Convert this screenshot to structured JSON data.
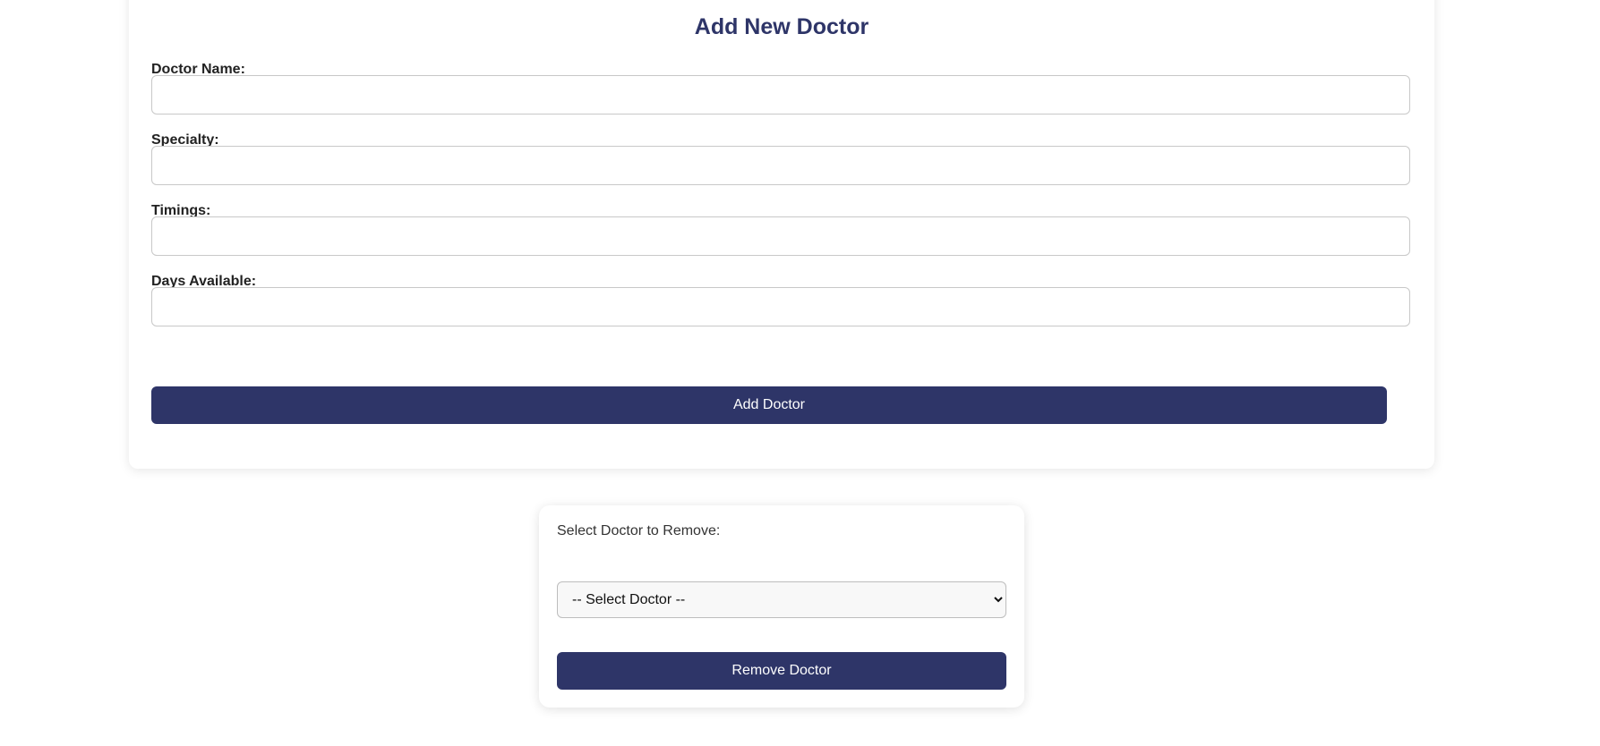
{
  "add_form": {
    "title": "Add New Doctor",
    "fields": [
      {
        "label": "Doctor Name:",
        "value": "",
        "placeholder": ""
      },
      {
        "label": "Specialty:",
        "value": "",
        "placeholder": ""
      },
      {
        "label": "Timings:",
        "value": "",
        "placeholder": ""
      },
      {
        "label": "Days Available:",
        "value": "",
        "placeholder": ""
      }
    ],
    "submit_label": "Add Doctor"
  },
  "remove_form": {
    "label": "Select Doctor to Remove:",
    "select_value": "-- Select Doctor --",
    "submit_label": "Remove Doctor"
  },
  "colors": {
    "accent": "#2e3568",
    "button_text": "#ffffff"
  }
}
